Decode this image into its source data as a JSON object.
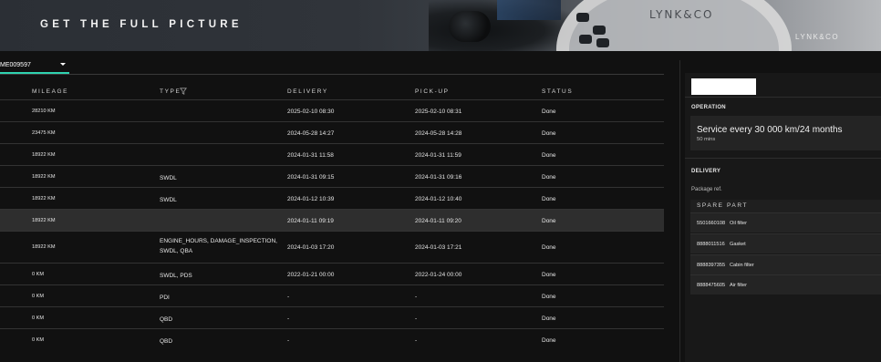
{
  "banner": {
    "tagline": "GET THE FULL PICTURE",
    "steering_wheel_brand": "LYNK&CO",
    "corner_brand": "LYNK&CO"
  },
  "vehicle_selector": {
    "value": "ME009597"
  },
  "table": {
    "columns": {
      "mileage": "MILEAGE",
      "type": "TYPE",
      "delivery": "DELIVERY",
      "pickup": "PICK-UP",
      "status": "STATUS"
    },
    "rows": [
      {
        "mileage": "28210 KM",
        "type": "",
        "delivery": "2025-02-10 08:30",
        "pickup": "2025-02-10 08:31",
        "status": "Done"
      },
      {
        "mileage": "23475 KM",
        "type": "",
        "delivery": "2024-05-28 14:27",
        "pickup": "2024-05-28 14:28",
        "status": "Done"
      },
      {
        "mileage": "18922 KM",
        "type": "",
        "delivery": "2024-01-31 11:58",
        "pickup": "2024-01-31 11:59",
        "status": "Done"
      },
      {
        "mileage": "18922 KM",
        "type": "SWDL",
        "delivery": "2024-01-31 09:15",
        "pickup": "2024-01-31 09:16",
        "status": "Done"
      },
      {
        "mileage": "18922 KM",
        "type": "SWDL",
        "delivery": "2024-01-12 10:39",
        "pickup": "2024-01-12 10:40",
        "status": "Done"
      },
      {
        "mileage": "18922 KM",
        "type": "",
        "delivery": "2024-01-11 09:19",
        "pickup": "2024-01-11 09:20",
        "status": "Done",
        "highlighted": true
      },
      {
        "mileage": "18922 KM",
        "type": "ENGINE_HOURS, DAMAGE_INSPECTION,\nSWDL, QBA",
        "delivery": "2024-01-03 17:20",
        "pickup": "2024-01-03 17:21",
        "status": "Done"
      },
      {
        "mileage": "0 KM",
        "type": "SWDL, PDS",
        "delivery": "2022-01-21 00:00",
        "pickup": "2022-01-24 00:00",
        "status": "Done"
      },
      {
        "mileage": "0 KM",
        "type": "PDI",
        "delivery": "-",
        "pickup": "-",
        "status": "Done"
      },
      {
        "mileage": "0 KM",
        "type": "QBD",
        "delivery": "-",
        "pickup": "-",
        "status": "Done"
      },
      {
        "mileage": "0 KM",
        "type": "QBD",
        "delivery": "-",
        "pickup": "-",
        "status": "Done"
      }
    ]
  },
  "details": {
    "operation_label": "OPERATION",
    "operation_title": "Service every 30 000 km/24 months",
    "operation_duration": "50 mins",
    "delivery_label": "DELIVERY",
    "package_ref_label": "Package ref.",
    "spare_part_header": "SPARE PART",
    "spare_parts": [
      {
        "number": "5501660108",
        "name": "Oil filter"
      },
      {
        "number": "8888011516",
        "name": "Gasket"
      },
      {
        "number": "8888397355",
        "name": "Cabin filter"
      },
      {
        "number": "8888475605",
        "name": "Air filter"
      }
    ]
  },
  "colors": {
    "accent": "#2fd3b0",
    "background": "#111111",
    "highlight_row": "#2e2e2e"
  }
}
